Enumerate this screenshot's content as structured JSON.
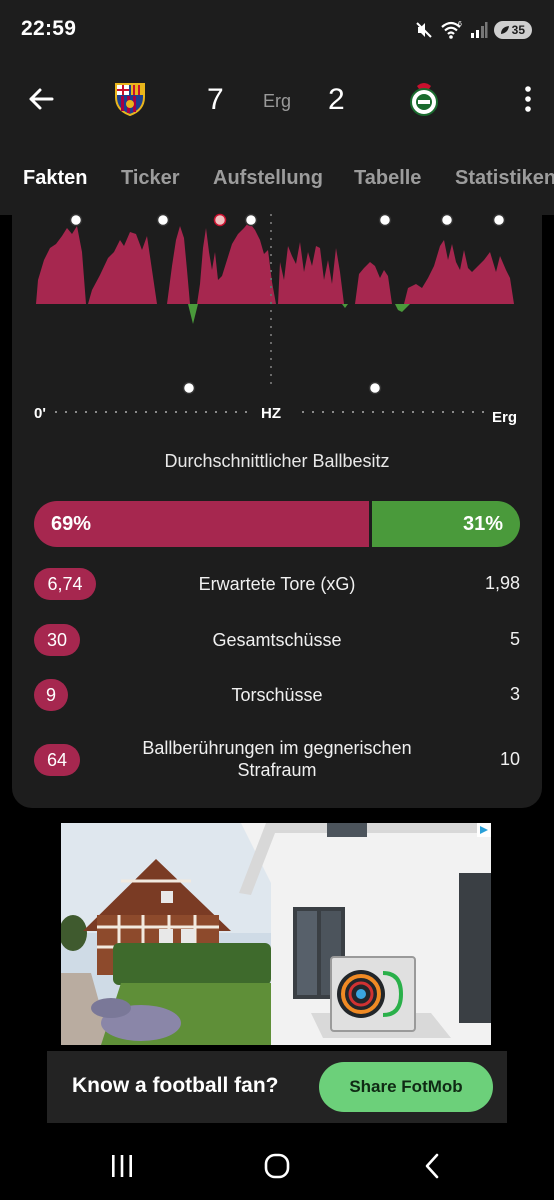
{
  "status_bar": {
    "time": "22:59",
    "battery": "35",
    "wifi_badge": "6"
  },
  "match": {
    "home_score": "7",
    "away_score": "2",
    "status": "Erg"
  },
  "tabs": [
    {
      "label": "Fakten",
      "active": true
    },
    {
      "label": "Ticker",
      "active": false
    },
    {
      "label": "Aufstellung",
      "active": false
    },
    {
      "label": "Tabelle",
      "active": false
    },
    {
      "label": "Statistiken",
      "active": false
    }
  ],
  "momentum": {
    "start_label": "0'",
    "half_label": "HZ",
    "end_label": "Erg",
    "home_color": "#a6274f",
    "away_color": "#4a9a3b"
  },
  "possession": {
    "title": "Durchschnittlicher Ballbesitz",
    "home_label": "69%",
    "away_label": "31%",
    "home_fraction": 0.69
  },
  "stats": [
    {
      "label": "Erwartete Tore (xG)",
      "home": "6,74",
      "away": "1,98"
    },
    {
      "label": "Gesamtschüsse",
      "home": "30",
      "away": "5"
    },
    {
      "label": "Torschüsse",
      "home": "9",
      "away": "3"
    },
    {
      "label": "Ballberührungen im gegnerischen Strafraum",
      "home": "64",
      "away": "10"
    }
  ],
  "ad": {
    "text": "Know a football fan?",
    "button": "Share FotMob"
  }
}
